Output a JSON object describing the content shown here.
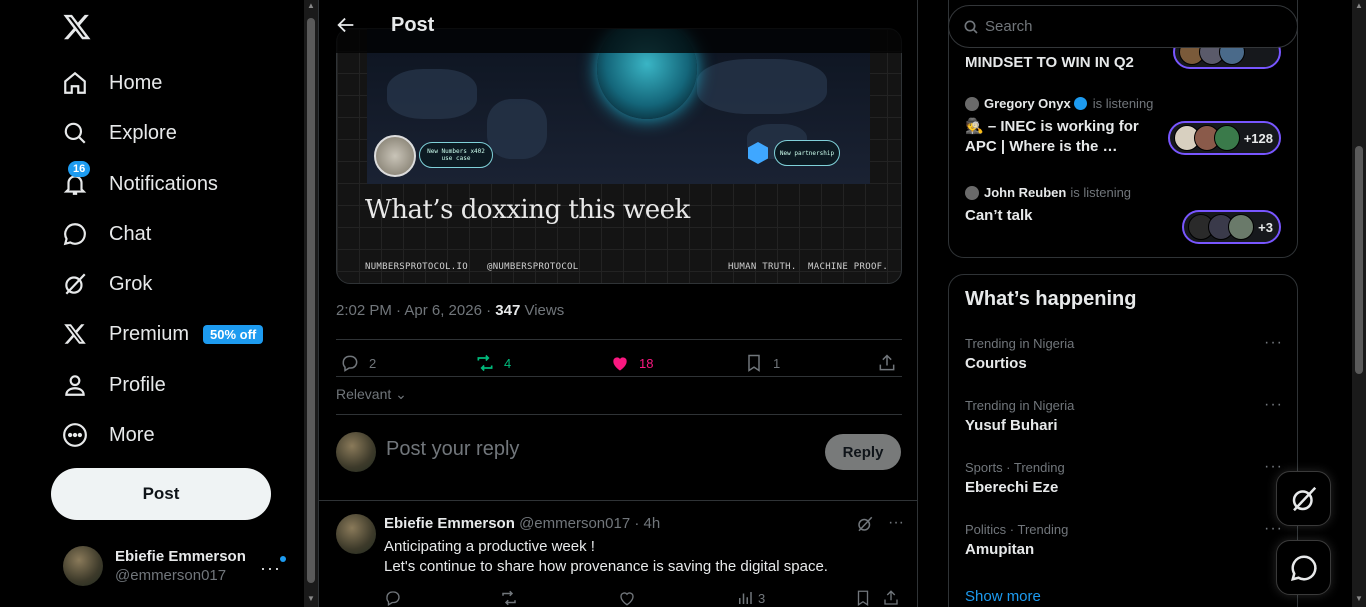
{
  "nav": {
    "items": [
      {
        "label": "Home",
        "icon": "home-icon"
      },
      {
        "label": "Explore",
        "icon": "search-icon"
      },
      {
        "label": "Notifications",
        "icon": "bell-icon",
        "badge": "16"
      },
      {
        "label": "Chat",
        "icon": "chat-icon"
      },
      {
        "label": "Grok",
        "icon": "grok-icon"
      },
      {
        "label": "Premium",
        "icon": "x-logo-icon",
        "promo": "50% off"
      },
      {
        "label": "Profile",
        "icon": "person-icon"
      },
      {
        "label": "More",
        "icon": "more-circle-icon"
      }
    ],
    "post_button": "Post"
  },
  "account": {
    "name": "Ebiefie Emmerson",
    "handle": "@emmerson017",
    "more": "···"
  },
  "header": {
    "title": "Post"
  },
  "media": {
    "headline": "What’s doxxing this week",
    "pill_left": "New Numbers x402 use case",
    "pill_right": "New partnership",
    "footer_left": "NUMBERSPROTOCOL.IO",
    "footer_mid": "@NUMBERSPROTOCOL",
    "footer_right": "HUMAN TRUTH.  MACHINE PROOF."
  },
  "post_meta": {
    "time": "2:02 PM · Apr 6, 2026 · ",
    "views_count": "347",
    "views_label": " Views"
  },
  "actions": {
    "replies": "2",
    "reposts": "4",
    "likes": "18",
    "bookmarks": "1"
  },
  "colors": {
    "repost": "#00ba7c",
    "like": "#f91880",
    "accent": "#1d9bf0",
    "spaces_border": "#7856ff"
  },
  "sort": {
    "label": "Relevant"
  },
  "reply_box": {
    "placeholder": "Post your reply",
    "button": "Reply"
  },
  "comment": {
    "name": "Ebiefie Emmerson",
    "handle": "@emmerson017 · 4h",
    "line1": "Anticipating a productive week !",
    "line2": "Let's continue to share how provenance is saving the digital space.",
    "views": "3"
  },
  "search": {
    "placeholder": "Search"
  },
  "spaces": [
    {
      "title": "MINDSET TO WIN IN Q2"
    },
    {
      "host": "Gregory Onyx",
      "status": "is listening",
      "title": "🕵️ – INEC is working for APC | Where is the …",
      "count": "+128"
    },
    {
      "host": "John Reuben",
      "status": "is listening",
      "title": "Can’t talk",
      "count": "+3"
    }
  ],
  "happening": {
    "title": "What’s happening",
    "trends": [
      {
        "meta": "Trending in Nigeria",
        "name": "Courtios"
      },
      {
        "meta": "Trending in Nigeria",
        "name": "Yusuf Buhari"
      },
      {
        "meta": "Sports · Trending",
        "name": "Eberechi Eze"
      },
      {
        "meta": "Politics · Trending",
        "name": "Amupitan"
      }
    ],
    "show_more": "Show more"
  }
}
